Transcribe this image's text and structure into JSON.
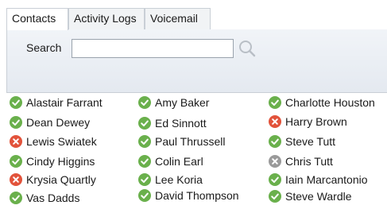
{
  "tabs": [
    {
      "label": "Contacts",
      "active": true
    },
    {
      "label": "Activity Logs",
      "active": false
    },
    {
      "label": "Voicemail",
      "active": false
    }
  ],
  "search": {
    "label": "Search",
    "value": "",
    "placeholder": "",
    "icon": "search-icon"
  },
  "status_colors": {
    "available": "#6ab04c",
    "busy": "#e2533b",
    "offline": "#9a9a9a"
  },
  "contacts": [
    {
      "name": "Alastair Farrant",
      "status": "available"
    },
    {
      "name": "Amy Baker",
      "status": "available"
    },
    {
      "name": "Charlotte Houston",
      "status": "available"
    },
    {
      "name": "Dean Dewey",
      "status": "available"
    },
    {
      "name": "Ed Sinnott",
      "status": "available"
    },
    {
      "name": "Harry Brown",
      "status": "busy"
    },
    {
      "name": "Lewis Swiatek",
      "status": "busy"
    },
    {
      "name": "Paul Thrussell",
      "status": "available"
    },
    {
      "name": "Steve Tutt",
      "status": "available"
    },
    {
      "name": "Cindy Higgins",
      "status": "available"
    },
    {
      "name": "Colin Earl",
      "status": "available"
    },
    {
      "name": "Chris Tutt",
      "status": "offline"
    },
    {
      "name": "Krysia Quartly",
      "status": "busy"
    },
    {
      "name": "Lee Koria",
      "status": "available"
    },
    {
      "name": "Iain Marcantonio",
      "status": "available"
    },
    {
      "name": "Vas Dadds",
      "status": "available"
    },
    {
      "name": "David Thompson",
      "status": "available"
    },
    {
      "name": "Steve Wardle",
      "status": "available"
    }
  ]
}
